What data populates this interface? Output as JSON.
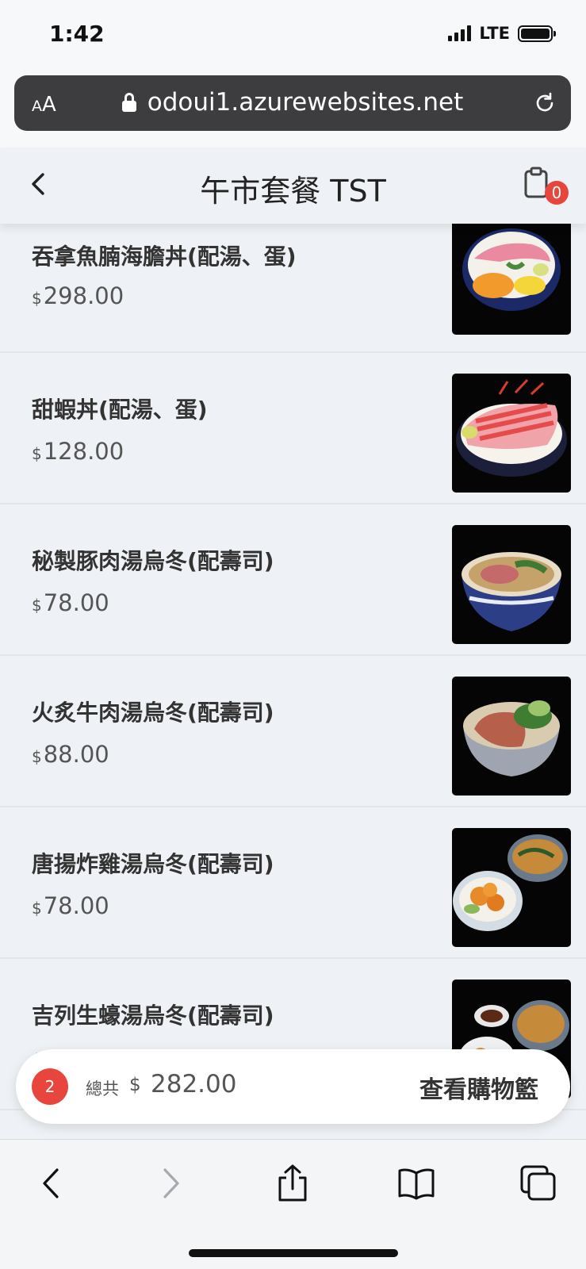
{
  "status": {
    "time": "1:42",
    "network": "LTE"
  },
  "browser": {
    "text_size_label": "AA",
    "url": "odoui1.azurewebsites.net"
  },
  "header": {
    "title": "午市套餐 TST",
    "cart_count": "0"
  },
  "menu": {
    "currency": "$",
    "items": [
      {
        "name": "吞拿魚腩海膽丼(配湯、蛋)",
        "price": "298.00"
      },
      {
        "name": "甜蝦丼(配湯、蛋)",
        "price": "128.00"
      },
      {
        "name": "秘製豚肉湯烏冬(配壽司)",
        "price": "78.00"
      },
      {
        "name": "火炙牛肉湯烏冬(配壽司)",
        "price": "88.00"
      },
      {
        "name": "唐揚炸雞湯烏冬(配壽司)",
        "price": "78.00"
      },
      {
        "name": "吉列生蠔湯烏冬(配壽司)",
        "price": ""
      }
    ]
  },
  "cart": {
    "count": "2",
    "total_label": "總共",
    "currency": "$",
    "total": "282.00",
    "view_label": "查看購物籃"
  },
  "colors": {
    "accent_red": "#e8453c",
    "url_bar": "#3d3d3f",
    "background": "#eef1f5"
  }
}
